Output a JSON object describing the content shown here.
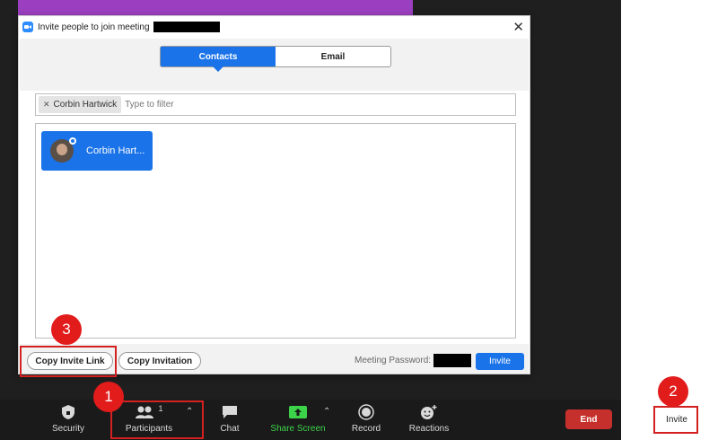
{
  "dialog": {
    "title": "Invite people to join meeting",
    "tabs": [
      "Contacts",
      "Email"
    ],
    "active_tab": "Contacts",
    "filter": {
      "chip_label": "Corbin Hartwick",
      "placeholder": "Type to filter"
    },
    "contacts": [
      {
        "name": "Corbin Hart..."
      }
    ],
    "footer": {
      "copy_invite_link": "Copy Invite Link",
      "copy_invitation": "Copy Invitation",
      "meeting_password_label": "Meeting Password:",
      "invite_button": "Invite"
    }
  },
  "toolbar": {
    "security": "Security",
    "participants": "Participants",
    "participant_count": "1",
    "chat": "Chat",
    "share_screen": "Share Screen",
    "record": "Record",
    "reactions": "Reactions",
    "end": "End"
  },
  "side_panel": {
    "invite": "Invite"
  },
  "annotations": {
    "step_1": "1",
    "step_2": "2",
    "step_3": "3"
  },
  "colors": {
    "accent": "#1a73e8",
    "share_green": "#3cd34a",
    "end_red": "#c6302c",
    "annotation_red": "#e21b1b",
    "video_purple": "#9b3fc0"
  }
}
